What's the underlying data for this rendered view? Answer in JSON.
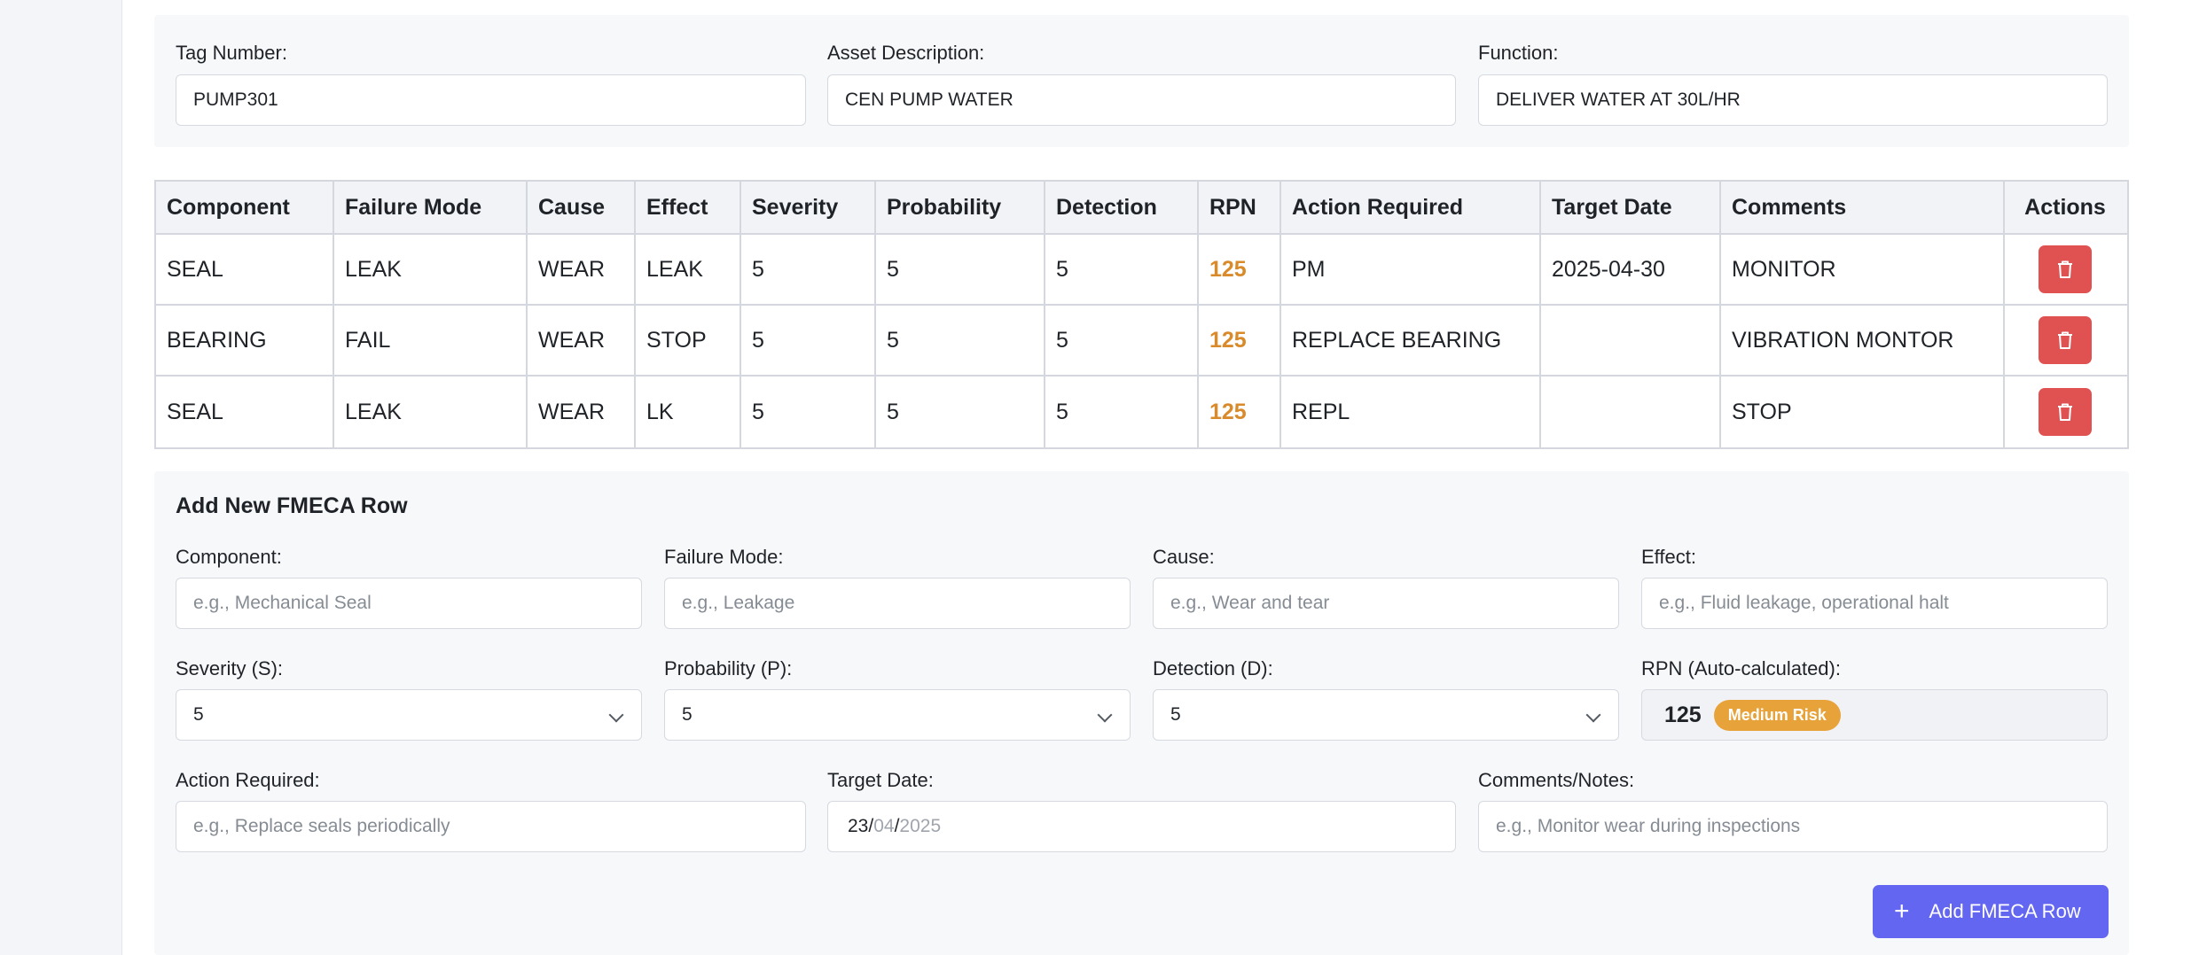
{
  "asset": {
    "tag_label": "Tag Number:",
    "tag_value": "PUMP301",
    "desc_label": "Asset Description:",
    "desc_value": "CEN PUMP WATER",
    "function_label": "Function:",
    "function_value": "DELIVER WATER AT 30L/HR"
  },
  "table": {
    "headers": [
      "Component",
      "Failure Mode",
      "Cause",
      "Effect",
      "Severity",
      "Probability",
      "Detection",
      "RPN",
      "Action Required",
      "Target Date",
      "Comments",
      "Actions"
    ],
    "rows": [
      {
        "component": "SEAL",
        "failure_mode": "LEAK",
        "cause": "WEAR",
        "effect": "LEAK",
        "severity": "5",
        "probability": "5",
        "detection": "5",
        "rpn": "125",
        "action": "PM",
        "target_date": "2025-04-30",
        "comments": "MONITOR"
      },
      {
        "component": "BEARING",
        "failure_mode": "FAIL",
        "cause": "WEAR",
        "effect": "STOP",
        "severity": "5",
        "probability": "5",
        "detection": "5",
        "rpn": "125",
        "action": "REPLACE BEARING",
        "target_date": "",
        "comments": "VIBRATION MONTOR"
      },
      {
        "component": "SEAL",
        "failure_mode": "LEAK",
        "cause": "WEAR",
        "effect": "LK",
        "severity": "5",
        "probability": "5",
        "detection": "5",
        "rpn": "125",
        "action": "REPL",
        "target_date": "",
        "comments": "STOP"
      }
    ]
  },
  "form": {
    "title": "Add New FMECA Row",
    "component_label": "Component:",
    "component_placeholder": "e.g., Mechanical Seal",
    "failure_mode_label": "Failure Mode:",
    "failure_mode_placeholder": "e.g., Leakage",
    "cause_label": "Cause:",
    "cause_placeholder": "e.g., Wear and tear",
    "effect_label": "Effect:",
    "effect_placeholder": "e.g., Fluid leakage, operational halt",
    "severity_label": "Severity (S):",
    "severity_value": "5",
    "probability_label": "Probability (P):",
    "probability_value": "5",
    "detection_label": "Detection (D):",
    "detection_value": "5",
    "rpn_label": "RPN (Auto-calculated):",
    "rpn_value": "125",
    "risk_badge": "Medium Risk",
    "action_label": "Action Required:",
    "action_placeholder": "e.g., Replace seals periodically",
    "target_date_label": "Target Date:",
    "target_date_day": "23",
    "target_date_month": "04",
    "target_date_year": "2025",
    "target_date_sep": "/",
    "comments_label": "Comments/Notes:",
    "comments_placeholder": "e.g., Monitor wear during inspections",
    "add_button": "Add FMECA Row",
    "add_icon": "+"
  },
  "colors": {
    "delete_button": "#e05252",
    "rpn_text": "#d98a2b",
    "risk_badge": "#e8a23a",
    "primary_button": "#6366f1"
  },
  "icons": {
    "row_delete": "trash-icon",
    "add": "plus-icon",
    "select": "chevron-down-icon"
  }
}
